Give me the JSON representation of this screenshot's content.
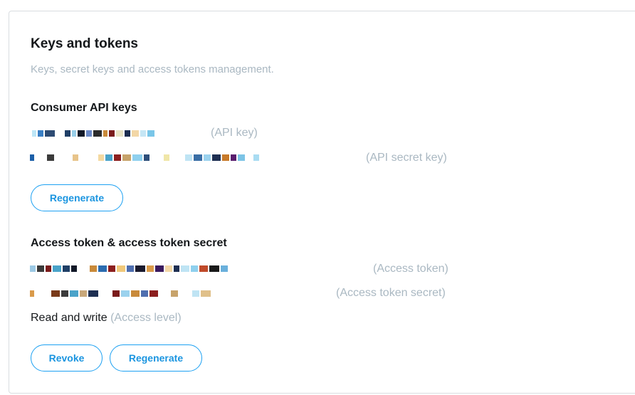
{
  "section": {
    "title": "Keys and tokens",
    "subtitle": "Keys, secret keys and access tokens management."
  },
  "consumer": {
    "heading": "Consumer API keys",
    "api_key_label": "(API key)",
    "api_secret_label": "(API secret key)",
    "regenerate_label": "Regenerate"
  },
  "access": {
    "heading": "Access token & access token secret",
    "token_label": "(Access token)",
    "secret_label": "(Access token secret)",
    "level_value": "Read and write",
    "level_label": "(Access level)",
    "revoke_label": "Revoke",
    "regenerate_label": "Regenerate"
  },
  "colors": {
    "accent": "#1da1f2",
    "muted": "#aab8c2",
    "border": "#d9dde0"
  }
}
